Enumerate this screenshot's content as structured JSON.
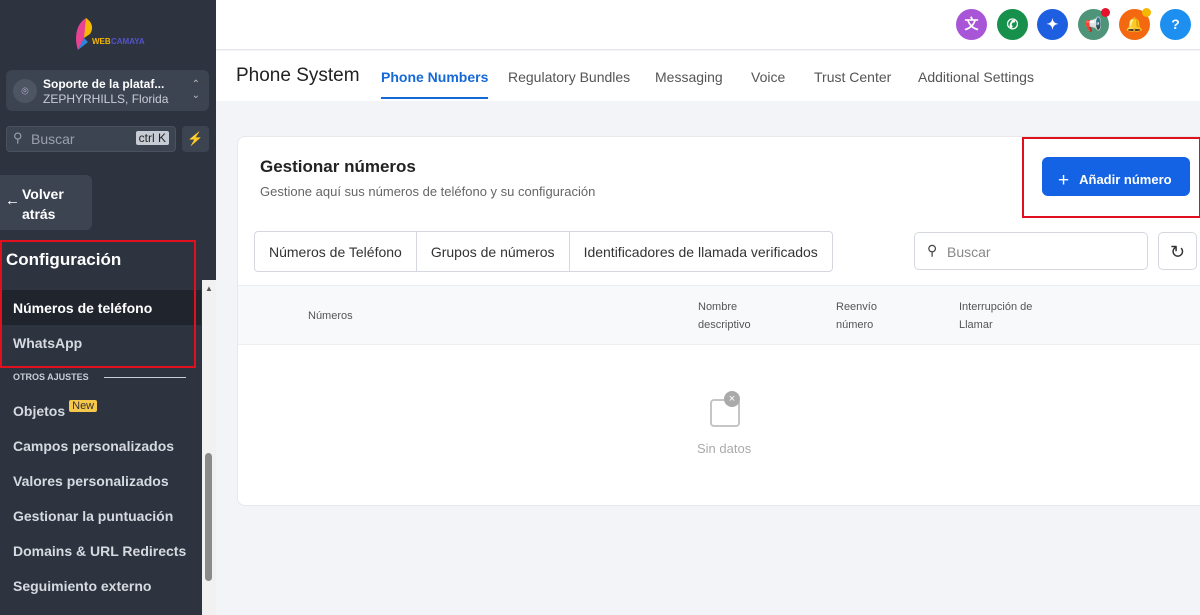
{
  "sidebar": {
    "logo_text": "WEBCAMAYA",
    "location": {
      "name": "Soporte de la plataf...",
      "city": "ZEPHYRHILLS, Florida"
    },
    "search": {
      "placeholder": "Buscar",
      "shortcut": "ctrl K"
    },
    "back_label_1": "Volver",
    "back_label_2": "atrás",
    "section_title": "Configuración",
    "items": [
      {
        "label": "Números de teléfono",
        "active": true
      },
      {
        "label": "WhatsApp"
      }
    ],
    "other_header": "OTROS AJUSTES",
    "other_items": [
      {
        "label": "Objetos",
        "badge": "New"
      },
      {
        "label": "Campos personalizados"
      },
      {
        "label": "Valores personalizados"
      },
      {
        "label": "Gestionar la puntuación"
      },
      {
        "label": "Domains & URL Redirects"
      },
      {
        "label": "Seguimiento externo"
      }
    ]
  },
  "topbar": {
    "icons": [
      {
        "name": "translate-icon",
        "color": "#a855d8"
      },
      {
        "name": "phone-icon",
        "color": "#16904a"
      },
      {
        "name": "sparkle-icon",
        "color": "#1d5fe0"
      },
      {
        "name": "megaphone-icon",
        "color": "#4d9478"
      },
      {
        "name": "bell-icon",
        "color": "#f4690f"
      },
      {
        "name": "help-icon",
        "color": "#1d8ff0",
        "label": "?"
      }
    ]
  },
  "nav": {
    "title": "Phone System",
    "tabs": [
      "Phone Numbers",
      "Regulatory Bundles",
      "Messaging",
      "Voice",
      "Trust Center",
      "Additional Settings"
    ]
  },
  "card": {
    "title": "Gestionar números",
    "subtitle": "Gestione aquí sus números de teléfono y su configuración",
    "add_button": "Añadir número",
    "segments": [
      "Números de Teléfono",
      "Grupos de números",
      "Identificadores de llamada verificados"
    ],
    "search_placeholder": "Buscar",
    "columns": [
      "Números",
      "Nombre descriptivo",
      "Reenvío número",
      "Interrupción de Llamar"
    ],
    "empty_text": "Sin datos"
  }
}
